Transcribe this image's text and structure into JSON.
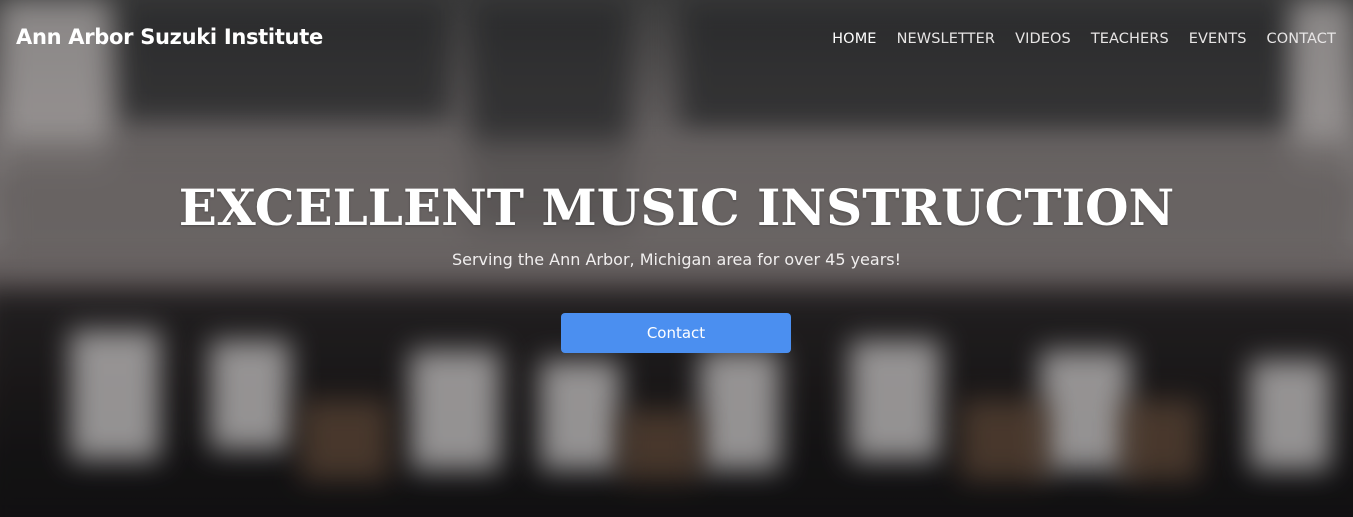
{
  "site": {
    "brand": "Ann Arbor Suzuki Institute"
  },
  "nav": {
    "items": [
      {
        "label": "HOME",
        "active": true
      },
      {
        "label": "NEWSLETTER",
        "active": false
      },
      {
        "label": "VIDEOS",
        "active": false
      },
      {
        "label": "TEACHERS",
        "active": false
      },
      {
        "label": "EVENTS",
        "active": false
      },
      {
        "label": "CONTACT",
        "active": false
      }
    ]
  },
  "hero": {
    "headline": "EXCELLENT MUSIC INSTRUCTION",
    "subheadline": "Serving the Ann Arbor, Michigan area for over 45 years!",
    "button_label": "Contact"
  },
  "colors": {
    "accent_button": "#4b8ff0",
    "text_white": "#ffffff"
  }
}
